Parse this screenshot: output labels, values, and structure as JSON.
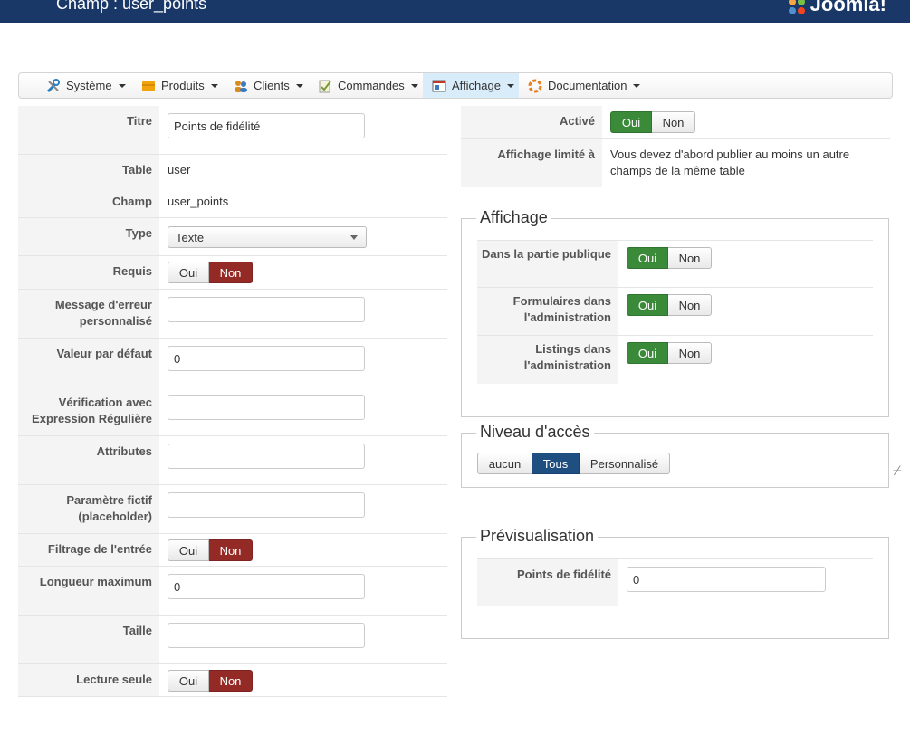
{
  "header": {
    "title": "Champ : user_points",
    "logo_text": "Joomla!",
    "bg_color": "#1a3867"
  },
  "menu": [
    {
      "label": "Système",
      "icon": "tools-icon",
      "color": "#2a7fc1"
    },
    {
      "label": "Produits",
      "icon": "box-icon",
      "color": "#f0a30a"
    },
    {
      "label": "Clients",
      "icon": "users-icon",
      "color": "#d98c1e"
    },
    {
      "label": "Commandes",
      "icon": "clipboard-icon",
      "color": "#7a9a3a"
    },
    {
      "label": "Affichage",
      "icon": "display-icon",
      "color": "#c0392b",
      "active": true
    },
    {
      "label": "Documentation",
      "icon": "lifebuoy-icon",
      "color": "#e67e22"
    }
  ],
  "toggle": {
    "yes": "Oui",
    "no": "Non"
  },
  "form": {
    "titre": {
      "label": "Titre",
      "value": "Points de fidélité"
    },
    "table": {
      "label": "Table",
      "value": "user"
    },
    "champ": {
      "label": "Champ",
      "value": "user_points"
    },
    "type": {
      "label": "Type",
      "value": "Texte"
    },
    "requis": {
      "label": "Requis",
      "selected": "Non"
    },
    "message_erreur": {
      "label": "Message d'erreur personnalisé",
      "value": ""
    },
    "valeur_defaut": {
      "label": "Valeur par défaut",
      "value": "0"
    },
    "verification": {
      "label": "Vérification avec Expression Régulière",
      "value": ""
    },
    "attributes": {
      "label": "Attributes",
      "value": ""
    },
    "placeholder": {
      "label": "Paramètre fictif (placeholder)",
      "value": ""
    },
    "filtrage": {
      "label": "Filtrage de l'entrée",
      "selected": "Non"
    },
    "longueur": {
      "label": "Longueur maximum",
      "value": "0"
    },
    "taille": {
      "label": "Taille",
      "value": ""
    },
    "lecture_seule": {
      "label": "Lecture seule",
      "selected": "Non"
    }
  },
  "right": {
    "active": {
      "label": "Activé",
      "selected": "Oui"
    },
    "affichage_limite": {
      "label": "Affichage limité à",
      "value": "Vous devez d'abord publier au moins un autre champs de la même table"
    }
  },
  "affichage": {
    "legend": "Affichage",
    "rows": [
      {
        "label": "Dans la partie publique",
        "selected": "Oui"
      },
      {
        "label": "Formulaires dans l'administration",
        "selected": "Oui"
      },
      {
        "label": "Listings dans l'administration",
        "selected": "Oui"
      }
    ]
  },
  "niveau": {
    "legend": "Niveau d'accès",
    "options": [
      "aucun",
      "Tous",
      "Personnalisé"
    ],
    "selected": "Tous"
  },
  "preview": {
    "legend": "Prévisualisation",
    "label": "Points de fidélité",
    "value": "0"
  }
}
